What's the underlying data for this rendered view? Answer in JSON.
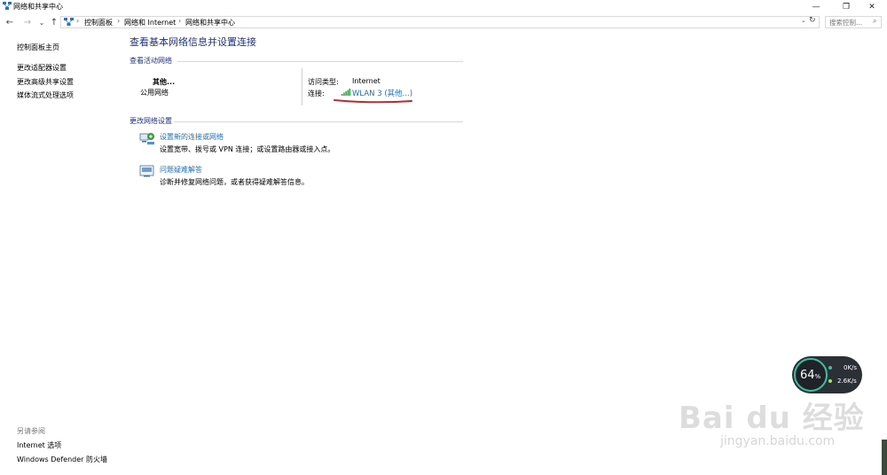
{
  "window": {
    "title": "网络和共享中心",
    "minimize_glyph": "—",
    "restore_glyph": "❐",
    "close_glyph": "✕"
  },
  "address_bar": {
    "back_glyph": "←",
    "forward_glyph": "→",
    "recent_glyph": "⌄",
    "up_glyph": "↑",
    "breadcrumbs": [
      "控制面板",
      "网络和 Internet",
      "网络和共享中心"
    ],
    "separator": "›",
    "dropdown_glyph": "⌄",
    "refresh_glyph": "↻",
    "search_placeholder": "搜索控制...",
    "search_glyph": "⌕"
  },
  "left_nav": {
    "items": [
      "控制面板主页",
      "更改适配器设置",
      "更改高级共享设置",
      "媒体流式处理选项"
    ],
    "see_also_title": "另请参阅",
    "see_also": [
      "Internet 选项",
      "Windows Defender 防火墙"
    ]
  },
  "main": {
    "title": "查看基本网络信息并设置连接",
    "active_networks_heading": "查看活动网络",
    "network_name": "其他...",
    "network_type": "公用网络",
    "access_type_label": "访问类型:",
    "access_type_value": "Internet",
    "connection_label": "连接:",
    "connection_value": "WLAN 3 (其他...)",
    "change_settings_heading": "更改网络设置",
    "tasks": [
      {
        "icon": "network-setup-icon",
        "title": "设置新的连接或网络",
        "desc": "设置宽带、拨号或 VPN 连接；或设置路由器或接入点。"
      },
      {
        "icon": "troubleshoot-icon",
        "title": "问题疑难解答",
        "desc": "诊断并修复网络问题，或者获得疑难解答信息。"
      }
    ]
  },
  "net_monitor": {
    "percent": "64",
    "percent_unit": "%",
    "upload": "0K/s",
    "download": "2.6K/s"
  },
  "watermark": {
    "main": "Bai du 经验",
    "sub": "jingyan.baidu.com"
  },
  "colors": {
    "heading_blue": "#1e3287",
    "link_blue": "#1e6fb7",
    "annotation_red": "#c0282d",
    "wifi_green": "#2e9e3a"
  }
}
